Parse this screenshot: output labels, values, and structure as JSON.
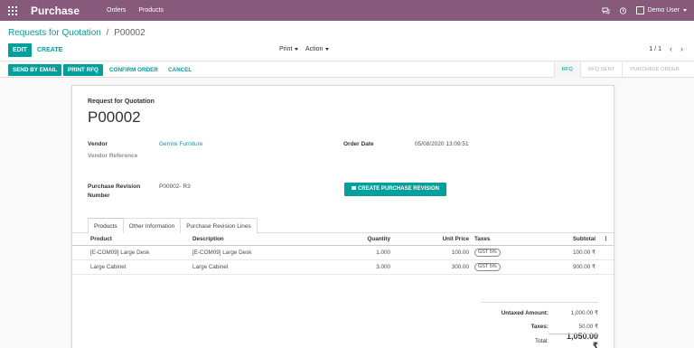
{
  "navbar": {
    "brand": "Purchase",
    "menu": [
      "Orders",
      "Products"
    ],
    "user": "Demo User"
  },
  "breadcrumb": {
    "parent": "Requests for Quotation",
    "separator": "/",
    "current": "P00002"
  },
  "toolbar": {
    "edit": "EDIT",
    "create": "CREATE",
    "print": "Print",
    "action": "Action",
    "pager": "1 / 1"
  },
  "statusbar": {
    "buttons": [
      "SEND BY EMAIL",
      "PRINT RFQ",
      "CONFIRM ORDER",
      "CANCEL"
    ],
    "stages": [
      "RFQ",
      "RFQ SENT",
      "PURCHASE ORDER"
    ]
  },
  "form": {
    "heading": "Request for Quotation",
    "name": "P00002",
    "vendor_label": "Vendor",
    "vendor_value": "Gemini Furniture",
    "vendor_ref_label": "Vendor Reference",
    "order_date_label": "Order Date",
    "order_date_value": "05/08/2020 13:09:51",
    "revision_label_1": "Purchase Revision",
    "revision_label_2": "Number",
    "revision_value": "P00002- R3",
    "revision_button": "CREATE PURCHASE REVISION"
  },
  "tabs": [
    "Products",
    "Other Information",
    "Purchase Revision Lines"
  ],
  "lines": {
    "headers": {
      "product": "Product",
      "description": "Description",
      "quantity": "Quantity",
      "unit_price": "Unit Price",
      "taxes": "Taxes",
      "subtotal": "Subtotal"
    },
    "rows": [
      {
        "product": "[E-COM09] Large Desk",
        "description": "[E-COM09] Large Desk",
        "quantity": "1.000",
        "unit_price": "100.00",
        "taxes": "GST 5%",
        "subtotal": "100.00 ₹"
      },
      {
        "product": "Large Cabinet",
        "description": "Large Cabinet",
        "quantity": "3.000",
        "unit_price": "300.00",
        "taxes": "GST 5%",
        "subtotal": "900.00 ₹"
      }
    ]
  },
  "totals": {
    "untaxed_label": "Untaxed Amount:",
    "untaxed_value": "1,000.00 ₹",
    "taxes_label": "Taxes:",
    "taxes_value": "50.00 ₹",
    "total_label": "Total:",
    "total_value": "1,050.00 ₹"
  },
  "colors": {
    "brand": "#875a7b",
    "accent": "#00a09d"
  }
}
